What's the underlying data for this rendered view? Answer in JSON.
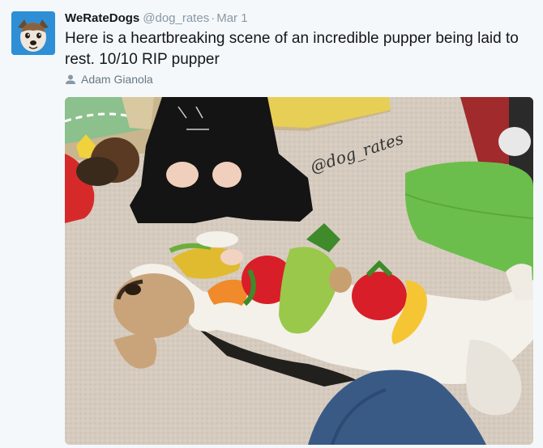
{
  "tweet": {
    "display_name": "WeRateDogs",
    "handle": "@dog_rates",
    "separator": "·",
    "date": "Mar 1",
    "text": "Here is a heartbreaking scene of an incredible pupper being laid to rest. 10/10 RIP pupper",
    "photo_credit": "Adam Gianola",
    "photo_credit_icon": "person-icon",
    "watermark": "@dog_rates"
  },
  "colors": {
    "background": "#f5f8fa",
    "name": "#14171a",
    "meta": "#8899a6",
    "credit": "#657786"
  }
}
